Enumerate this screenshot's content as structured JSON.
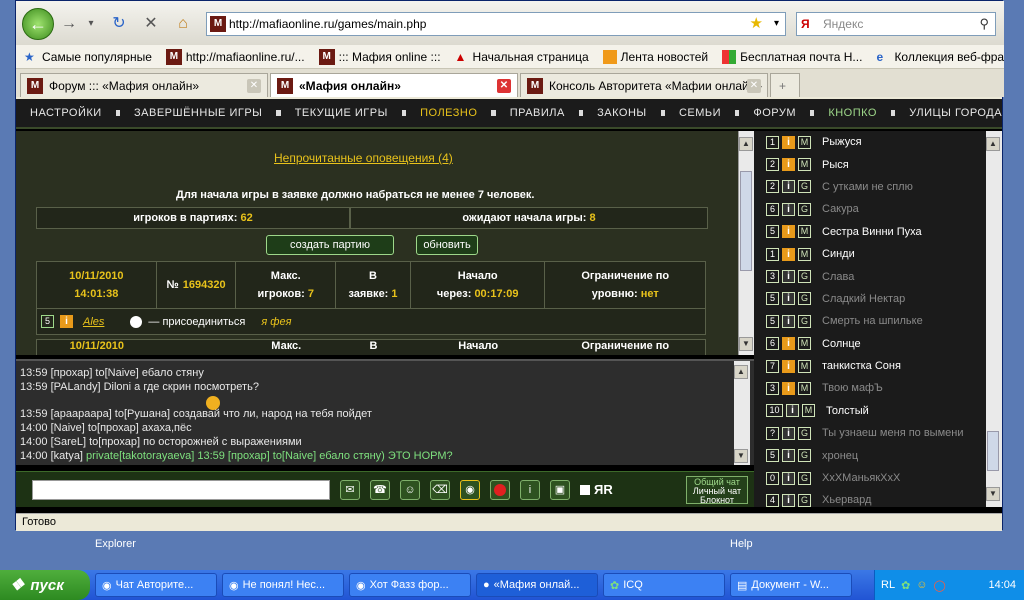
{
  "browser": {
    "url": "http://mafiaonline.ru/games/main.php",
    "search_placeholder": "Яндекс",
    "status": "Готово"
  },
  "favorites": [
    {
      "label": "Самые популярные",
      "icon": "star-icon"
    },
    {
      "label": "http://mafiaonline.ru/...",
      "icon": "mafia-icon"
    },
    {
      "label": "::: Мафия online :::",
      "icon": "mafia-icon"
    },
    {
      "label": "Начальная страница",
      "icon": "red-bird-icon"
    },
    {
      "label": "Лента новостей",
      "icon": "rss-icon"
    },
    {
      "label": "Бесплатная почта Н...",
      "icon": "windows-icon"
    },
    {
      "label": "Коллекция веб-фраг...",
      "icon": "ie-icon"
    }
  ],
  "tabs": [
    {
      "label": "Форум ::: «Мафия онлайн»",
      "active": false
    },
    {
      "label": "«Мафия онлайн»",
      "active": true
    },
    {
      "label": "Консоль Авторитета «Мафии онлайн»",
      "active": false
    }
  ],
  "site_nav": [
    {
      "label": "НАСТРОЙКИ",
      "highlight": false
    },
    {
      "label": "ЗАВЕРШЁННЫЕ ИГРЫ",
      "highlight": false
    },
    {
      "label": "ТЕКУЩИЕ ИГРЫ",
      "highlight": false
    },
    {
      "label": "ПОЛЕЗНО",
      "highlight": true
    },
    {
      "label": "ПРАВИЛА",
      "highlight": false
    },
    {
      "label": "ЗАКОНЫ",
      "highlight": false
    },
    {
      "label": "СЕМЬИ",
      "highlight": false
    },
    {
      "label": "ФОРУМ",
      "highlight": false
    },
    {
      "label": "КНОПКО",
      "highlight": false
    },
    {
      "label": "УЛИЦЫ ГОРОДА",
      "highlight": false
    }
  ],
  "game": {
    "notifications": "Непрочитанные оповещения (4)",
    "rule_text": "Для начала игры в заявке должно набраться не менее 7 человек.",
    "players_label": "игроков в партиях:",
    "players_value": "62",
    "waiting_label": "ожидают начала игры:",
    "waiting_value": "8",
    "create_button": "создать партию",
    "refresh_button": "обновить",
    "entry": {
      "date": "10/11/2010",
      "time": "14:01:38",
      "number_label": "№",
      "number": "1694320",
      "max_label_1": "Макс.",
      "max_label_2": "игроков:",
      "max_value": "7",
      "in_label_1": "В",
      "in_label_2": "заявке:",
      "in_value": "1",
      "start_label_1": "Начало",
      "start_label_2": "через:",
      "start_value": "00:17:09",
      "limit_label_1": "Ограничение по",
      "limit_label_2": "уровню:",
      "limit_value": "нет"
    },
    "player_row": {
      "level": "5",
      "name": "Ales",
      "join_text": "— присоединиться",
      "fairy": "я фея"
    },
    "next_entry": {
      "date": "10/11/2010",
      "max_label": "Макс.",
      "in_label": "В",
      "start_label": "Начало",
      "limit_label": "Ограничение по"
    }
  },
  "chat": {
    "lines": [
      {
        "text": "13:59 [прохар] to[Naive] ебало стяну",
        "green": false
      },
      {
        "text": "13:59 [PALandy] Diloni а где скрин посмотреть?",
        "green": false
      },
      {
        "text": "",
        "green": false
      },
      {
        "text": "13:59 [араараара] to[Рушана]       создавай что ли, народ на тебя пойдет",
        "green": false
      },
      {
        "text": "14:00 [Naive] to[прохар] ахаха,пёс",
        "green": false
      },
      {
        "text": "14:00 [SareL] to[прохар] по осторожней с выражениями",
        "green": false
      },
      {
        "text_prefix": "14:00 [katya] ",
        "text": "private[takotorayaeva] 13:59 [прохар] to[Naive] ебало стяну) ЭТО НОРМ?",
        "green": true
      }
    ],
    "modes": [
      "Общий чат",
      "Личный чат",
      "Блокнот"
    ],
    "jr_label": "ЯR"
  },
  "players": [
    {
      "num": "1",
      "type": "i",
      "mark": "M",
      "name": "Рыжуся",
      "dim": false
    },
    {
      "num": "2",
      "type": "i",
      "mark": "M",
      "name": "Рыся",
      "dim": false
    },
    {
      "num": "2",
      "type": "idark",
      "mark": "G",
      "name": "С утками не сплю",
      "dim": true
    },
    {
      "num": "6",
      "type": "idark",
      "mark": "G",
      "name": "Сакура",
      "dim": true
    },
    {
      "num": "5",
      "type": "i",
      "mark": "M",
      "name": "Сестра Винни Пуха",
      "dim": false
    },
    {
      "num": "1",
      "type": "i",
      "mark": "M",
      "name": "Синди",
      "dim": false
    },
    {
      "num": "3",
      "type": "idark",
      "mark": "G",
      "name": "Слава",
      "dim": true
    },
    {
      "num": "5",
      "type": "idark",
      "mark": "G",
      "name": "Сладкий Нектар",
      "dim": true
    },
    {
      "num": "5",
      "type": "idark",
      "mark": "G",
      "name": "Смерть на шпильке",
      "dim": true
    },
    {
      "num": "6",
      "type": "i",
      "mark": "M",
      "name": "Солнце",
      "dim": false
    },
    {
      "num": "7",
      "type": "i",
      "mark": "M",
      "name": "танкистка Соня",
      "dim": false
    },
    {
      "num": "3",
      "type": "i",
      "mark": "M",
      "name": "Твою мафЪ",
      "dim": true
    },
    {
      "num": "10",
      "type": "idark",
      "mark": "M",
      "name": "Толстый",
      "dim": false
    },
    {
      "num": "?",
      "type": "idark",
      "mark": "G",
      "name": "Ты узнаеш меня по вымени",
      "dim": true
    },
    {
      "num": "5",
      "type": "idark",
      "mark": "G",
      "name": "хронец",
      "dim": true
    },
    {
      "num": "0",
      "type": "idark",
      "mark": "G",
      "name": "ХхХМаньякХхХ",
      "dim": true
    },
    {
      "num": "4",
      "type": "idark",
      "mark": "G",
      "name": "Хьервард",
      "dim": true
    }
  ],
  "desktop": {
    "explorer_label": "Explorer",
    "help_label": "Help"
  },
  "taskbar": {
    "start": "пуск",
    "buttons": [
      "Чат Авторите...",
      "Не понял! Нес...",
      "Хот Фазз фор...",
      "«Мафия онлай...",
      "ICQ",
      "Документ - W..."
    ],
    "lang": "RL",
    "clock": "14:04"
  },
  "colors": {
    "accent_yellow": "#e8c21b",
    "panel_dark": "#2b3020",
    "chat_green": "#7ee07e"
  }
}
